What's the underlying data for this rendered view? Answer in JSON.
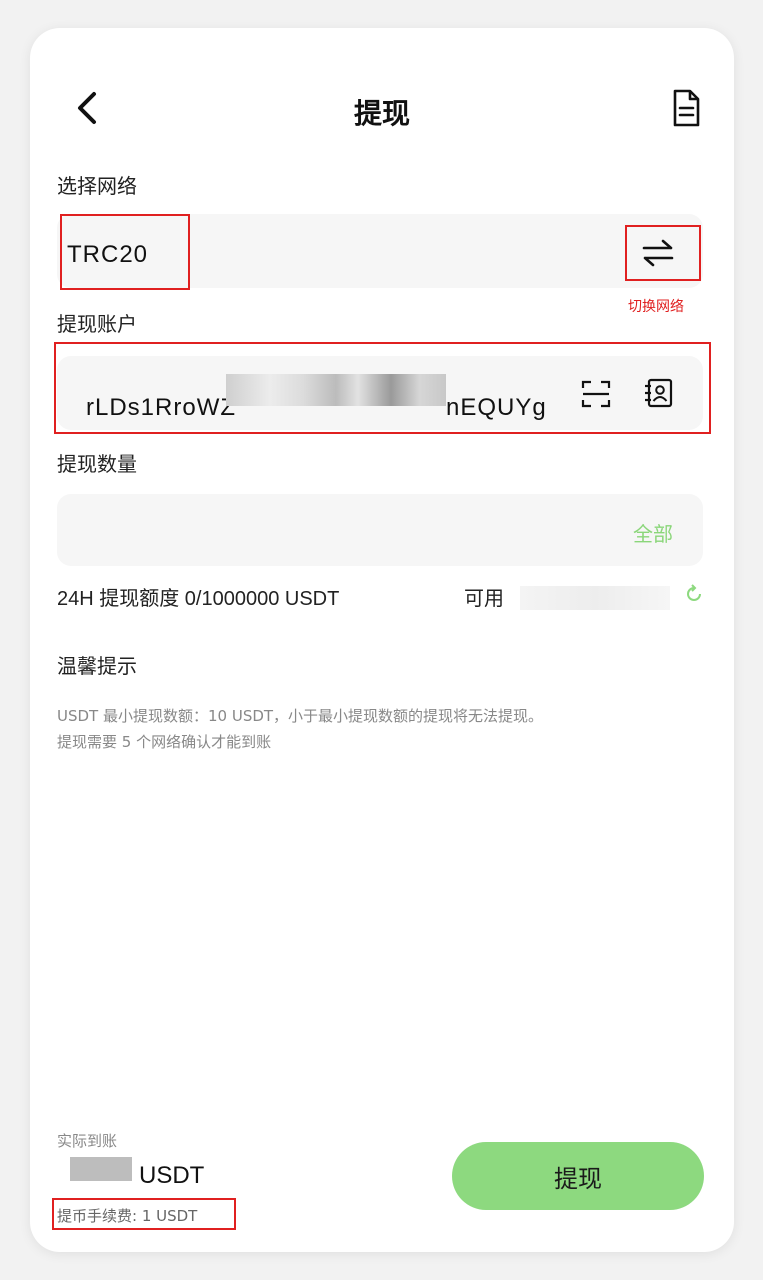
{
  "header": {
    "title": "提现"
  },
  "network": {
    "label": "选择网络",
    "value": "TRC20",
    "switch_hint": "切换网络"
  },
  "account": {
    "label": "提现账户",
    "address_start": "rLDs1RroWZ",
    "address_end": "nEQUYg"
  },
  "amount": {
    "label": "提现数量",
    "all_label": "全部"
  },
  "quota": {
    "text": "24H 提现额度 0/1000000 USDT",
    "available_label": "可用"
  },
  "tips": {
    "title": "温馨提示",
    "line1": "USDT 最小提现数额：10 USDT，小于最小提现数额的提现将无法提现。",
    "line2": "提现需要 5 个网络确认才能到账"
  },
  "footer": {
    "arrive_label": "实际到账",
    "arrive_unit": "USDT",
    "fee_text": "提币手续费: 1 USDT",
    "submit_label": "提现"
  },
  "colors": {
    "accent": "#8dd97f",
    "highlight": "#e02020"
  },
  "icons": [
    "back-chevron-icon",
    "record-document-icon",
    "switch-arrows-icon",
    "scan-icon",
    "address-book-icon",
    "refresh-icon"
  ]
}
